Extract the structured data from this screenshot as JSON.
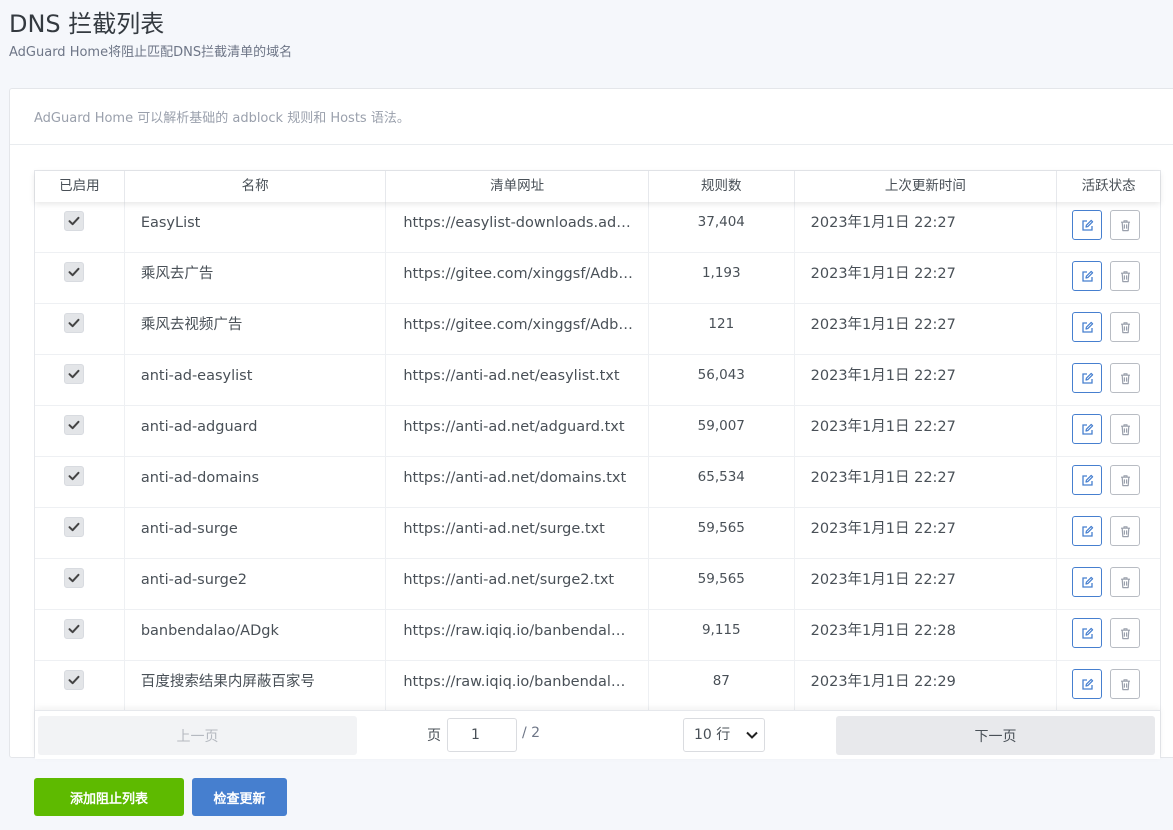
{
  "header": {
    "title": "DNS 拦截列表",
    "subtitle": "AdGuard Home将阻止匹配DNS拦截清单的域名"
  },
  "card": {
    "note": "AdGuard Home 可以解析基础的 adblock 规则和 Hosts 语法。"
  },
  "table": {
    "columns": [
      "已启用",
      "名称",
      "清单网址",
      "规则数",
      "上次更新时间",
      "活跃状态"
    ],
    "rows": [
      {
        "enabled": true,
        "name": "EasyList",
        "url": "https://easylist-downloads.adblockplus.org/easylistchina+easylist.txt",
        "rules": "37,404",
        "updated": "2023年1月1日 22:27"
      },
      {
        "enabled": true,
        "name": "乘风去广告",
        "url": "https://gitee.com/xinggsf/Adblock-Rule/raw/master/rule.txt",
        "rules": "1,193",
        "updated": "2023年1月1日 22:27"
      },
      {
        "enabled": true,
        "name": "乘风去视频广告",
        "url": "https://gitee.com/xinggsf/Adblock-Rule/raw/master/mv.txt",
        "rules": "121",
        "updated": "2023年1月1日 22:27"
      },
      {
        "enabled": true,
        "name": "anti-ad-easylist",
        "url": "https://anti-ad.net/easylist.txt",
        "rules": "56,043",
        "updated": "2023年1月1日 22:27"
      },
      {
        "enabled": true,
        "name": "anti-ad-adguard",
        "url": "https://anti-ad.net/adguard.txt",
        "rules": "59,007",
        "updated": "2023年1月1日 22:27"
      },
      {
        "enabled": true,
        "name": "anti-ad-domains",
        "url": "https://anti-ad.net/domains.txt",
        "rules": "65,534",
        "updated": "2023年1月1日 22:27"
      },
      {
        "enabled": true,
        "name": "anti-ad-surge",
        "url": "https://anti-ad.net/surge.txt",
        "rules": "59,565",
        "updated": "2023年1月1日 22:27"
      },
      {
        "enabled": true,
        "name": "anti-ad-surge2",
        "url": "https://anti-ad.net/surge2.txt",
        "rules": "59,565",
        "updated": "2023年1月1日 22:27"
      },
      {
        "enabled": true,
        "name": "banbendalao/ADgk",
        "url": "https://raw.iqiq.io/banbendalao/ADgk/master/ADgk.txt",
        "rules": "9,115",
        "updated": "2023年1月1日 22:28"
      },
      {
        "enabled": true,
        "name": "百度搜索结果内屏蔽百家号",
        "url": "https://raw.iqiq.io/banbendalao/ADgk/master/kill-baidu-ad.txt",
        "rules": "87",
        "updated": "2023年1月1日 22:29"
      }
    ]
  },
  "pagination": {
    "prev_label": "上一页",
    "next_label": "下一页",
    "page_label": "页",
    "current_page": "1",
    "total_pages": "/ 2",
    "rows_per_page": "10 行"
  },
  "actions": {
    "add_label": "添加阻止列表",
    "check_label": "检查更新"
  },
  "colors": {
    "primary": "#467fcf",
    "success": "#5eba00"
  }
}
